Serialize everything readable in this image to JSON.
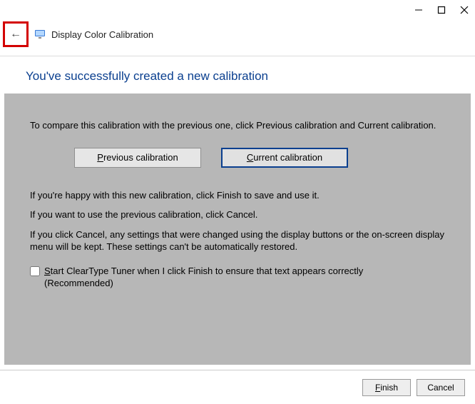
{
  "window": {
    "title": "Display Color Calibration"
  },
  "heading": "You've successfully created a new calibration",
  "body": {
    "compare_text": "To compare this calibration with the previous one, click Previous calibration and Current calibration.",
    "previous_btn": "Previous calibration",
    "current_btn": "Current calibration",
    "happy_text": "If you're happy with this new calibration, click Finish to save and use it.",
    "use_previous_text": "If you want to use the previous calibration, click Cancel.",
    "cancel_note": "If you click Cancel, any settings that were changed using the display buttons or the on-screen display menu will be kept. These settings can't be automatically restored.",
    "checkbox_label": "Start ClearType Tuner when I click Finish to ensure that text appears correctly (Recommended)"
  },
  "footer": {
    "finish": "Finish",
    "cancel": "Cancel"
  }
}
